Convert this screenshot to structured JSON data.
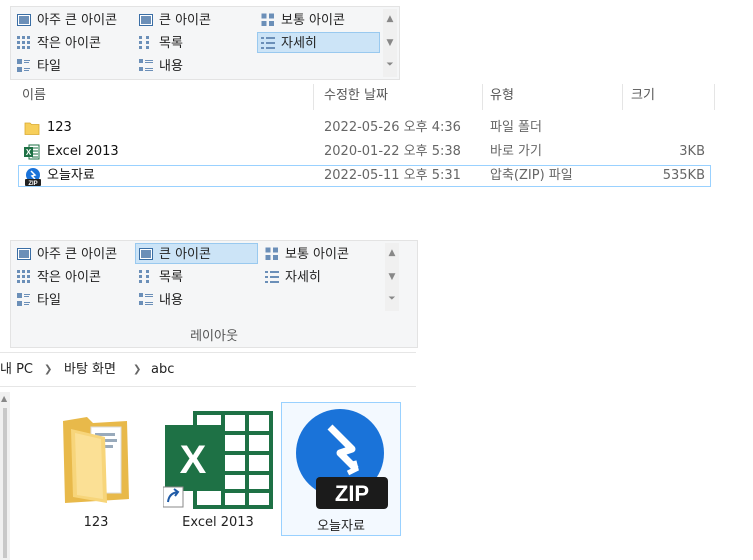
{
  "ribbon_top": {
    "items": [
      "아주 큰 아이콘",
      "큰 아이콘",
      "보통 아이콘",
      "작은 아이콘",
      "목록",
      "자세히",
      "타일",
      "내용"
    ],
    "selected": "자세히"
  },
  "details": {
    "headers": {
      "name": "이름",
      "date": "수정한 날짜",
      "type": "유형",
      "size": "크기"
    },
    "rows": [
      {
        "name": "123",
        "date": "2022-05-26 오후 4:36",
        "type": "파일 폴더",
        "size": ""
      },
      {
        "name": "Excel 2013",
        "date": "2020-01-22 오후 5:38",
        "type": "바로 가기",
        "size": "3KB"
      },
      {
        "name": "오늘자료",
        "date": "2022-05-11 오후 5:31",
        "type": "압축(ZIP) 파일",
        "size": "535KB"
      }
    ]
  },
  "ribbon_bottom": {
    "items": [
      "아주 큰 아이콘",
      "큰 아이콘",
      "보통 아이콘",
      "작은 아이콘",
      "목록",
      "자세히",
      "타일",
      "내용"
    ],
    "selected": "큰 아이콘",
    "group_label": "레이아웃"
  },
  "breadcrumb": [
    "내 PC",
    "바탕 화면",
    "abc"
  ],
  "tiles": [
    {
      "label": "123",
      "icon": "folder-icon"
    },
    {
      "label": "Excel 2013",
      "icon": "excel-shortcut-icon"
    },
    {
      "label": "오늘자료",
      "icon": "zip-icon"
    }
  ],
  "zip_badge_text": "ZIP",
  "excel_letter": "X",
  "colors": {
    "selection": "#cce4f7",
    "selection_border": "#99c9ef",
    "excel_green": "#1e7145",
    "zip_blue": "#1a73d9"
  }
}
